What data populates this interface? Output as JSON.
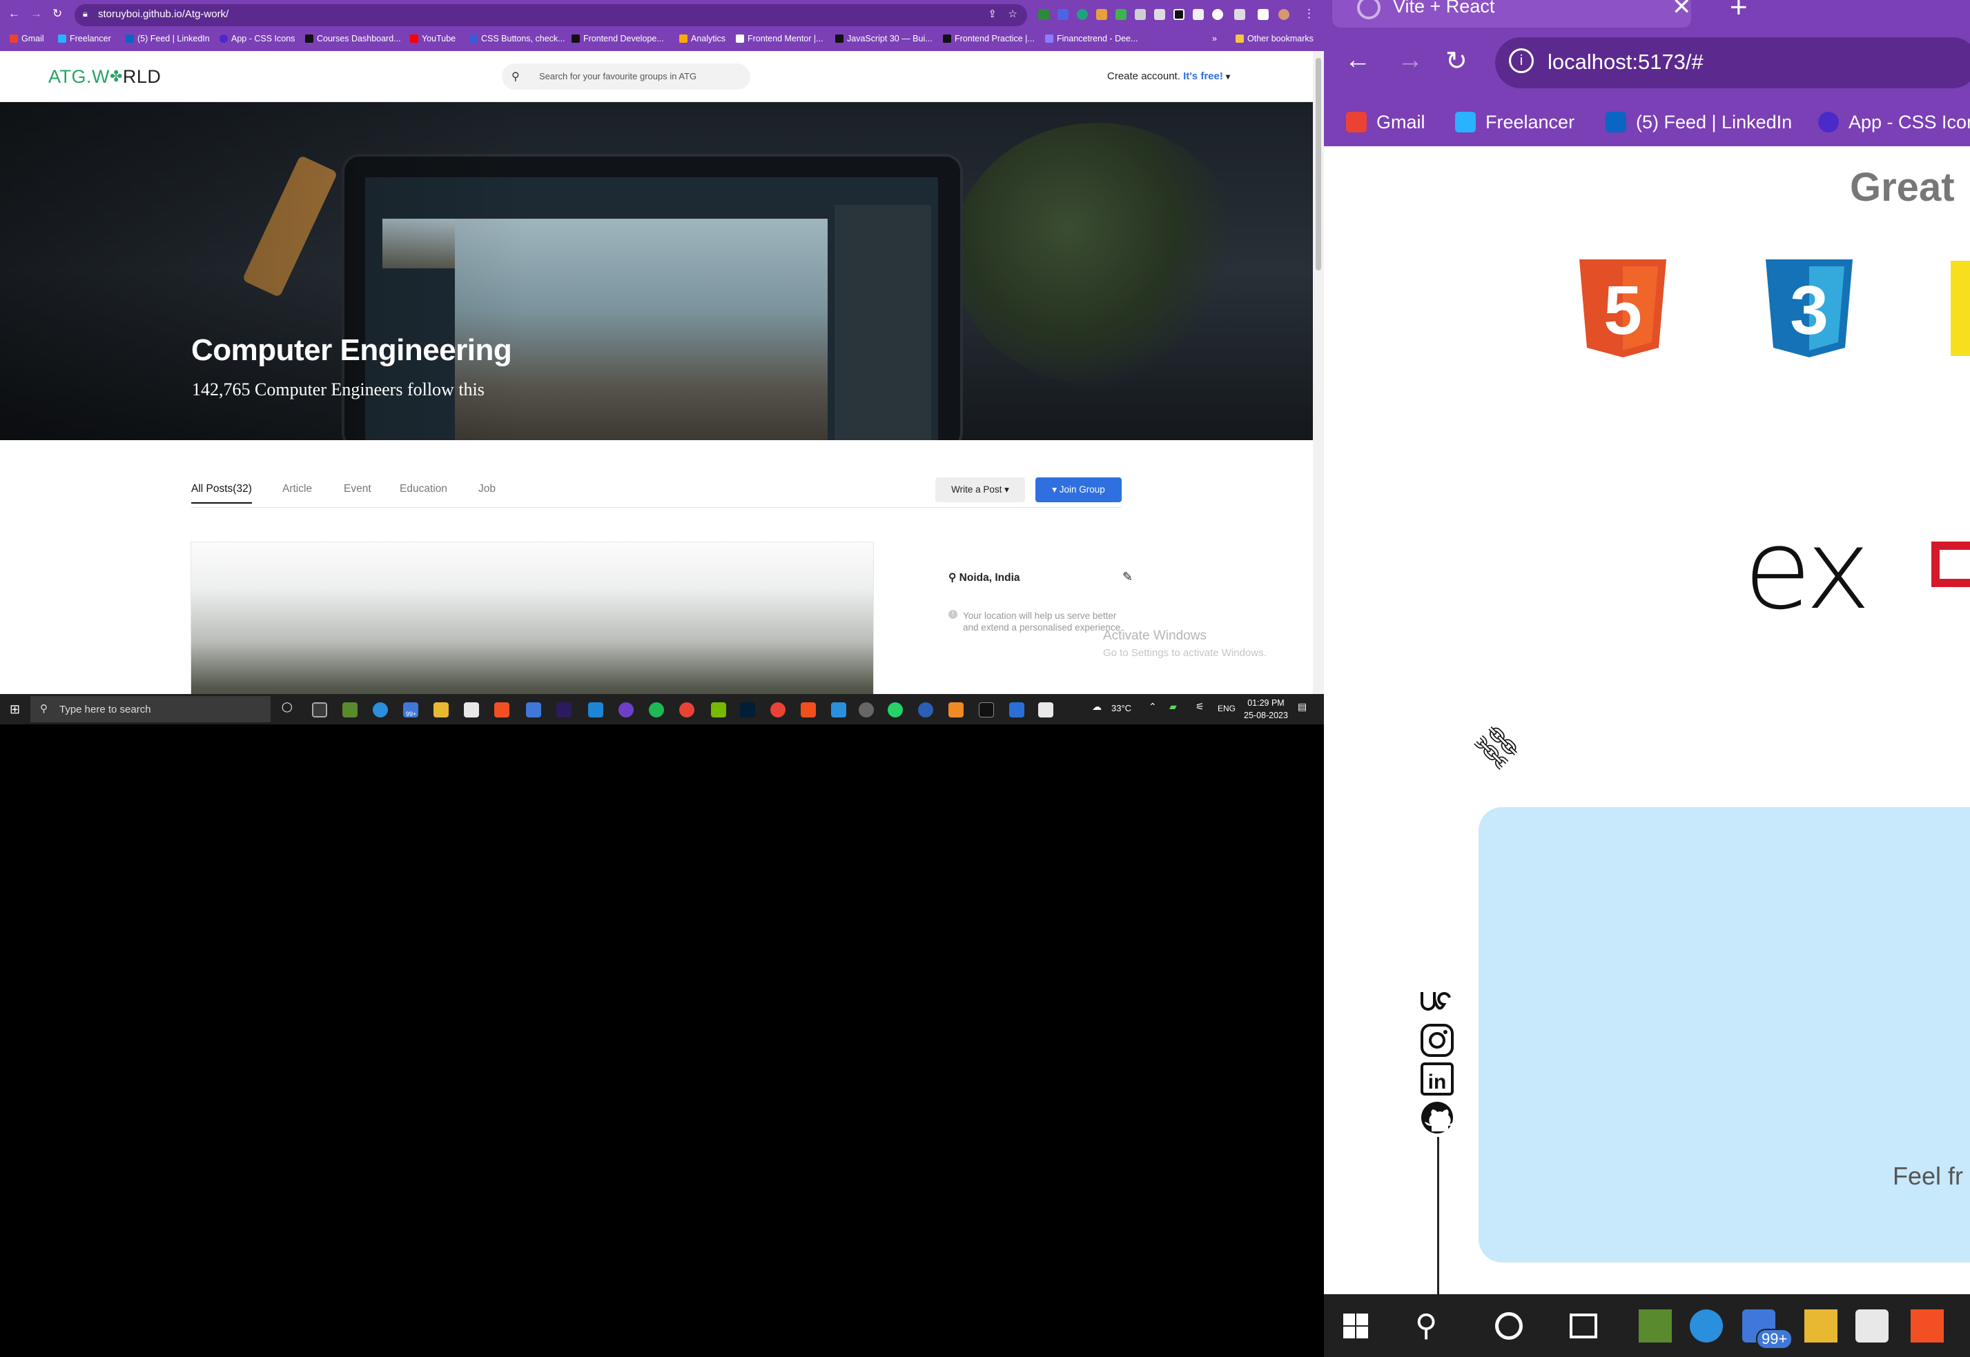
{
  "left": {
    "browser": {
      "url": "storuyboi.github.io/Atg-work/",
      "bookmarks": [
        "Gmail",
        "Freelancer",
        "(5) Feed | LinkedIn",
        "App - CSS Icons",
        "Courses Dashboard...",
        "YouTube",
        "CSS Buttons, check...",
        "Frontend Develope...",
        "Analytics",
        "Frontend Mentor |...",
        "JavaScript 30 — Bui...",
        "Frontend Practice |...",
        "Financetrend - Dee...",
        "»",
        "Other bookmarks"
      ]
    },
    "site": {
      "logo_main": "ATG.W",
      "logo_dot": "✤",
      "logo_end": "RLD",
      "search_placeholder": "Search for your favourite groups in ATG",
      "account_text": "Create account.",
      "account_link": "It's free!",
      "account_caret": "▾"
    },
    "hero": {
      "title": "Computer Engineering",
      "subtitle": "142,765 Computer Engineers follow this"
    },
    "tabs": [
      "All Posts(32)",
      "Article",
      "Event",
      "Education",
      "Job"
    ],
    "buttons": {
      "write": "Write a Post ▾",
      "join": "▾ Join Group"
    },
    "location": {
      "label": "Noida, India",
      "note_line1": "Your location will help us serve better",
      "note_line2": "and extend a personalised experience."
    },
    "watermark": {
      "line1": "Activate Windows",
      "line2": "Go to Settings to activate Windows."
    },
    "taskbar": {
      "search_placeholder": "Type here to search",
      "weather": "33°C",
      "lang": "ENG",
      "time": "01:29 PM",
      "date": "25-08-2023",
      "badge": "99+"
    }
  },
  "right": {
    "browser": {
      "tab_title": "Vite + React",
      "url": "localhost:5173/#",
      "bookmarks": [
        "Gmail",
        "Freelancer",
        "(5) Feed | LinkedIn",
        "App - CSS Icons"
      ]
    },
    "page": {
      "heading": "Great",
      "ex_text": "ex",
      "feel_text": "Feel fr",
      "social_icons": [
        "upwork-icon",
        "instagram-icon",
        "linkedin-icon",
        "github-icon"
      ]
    },
    "taskbar": {
      "badge": "99+"
    }
  },
  "colors": {
    "chrome_purple": "#7b3fb6",
    "join_blue": "#2f6fe0",
    "atg_green": "#27a365",
    "card_blue": "#c8e8fb",
    "taskbar": "#202020"
  }
}
